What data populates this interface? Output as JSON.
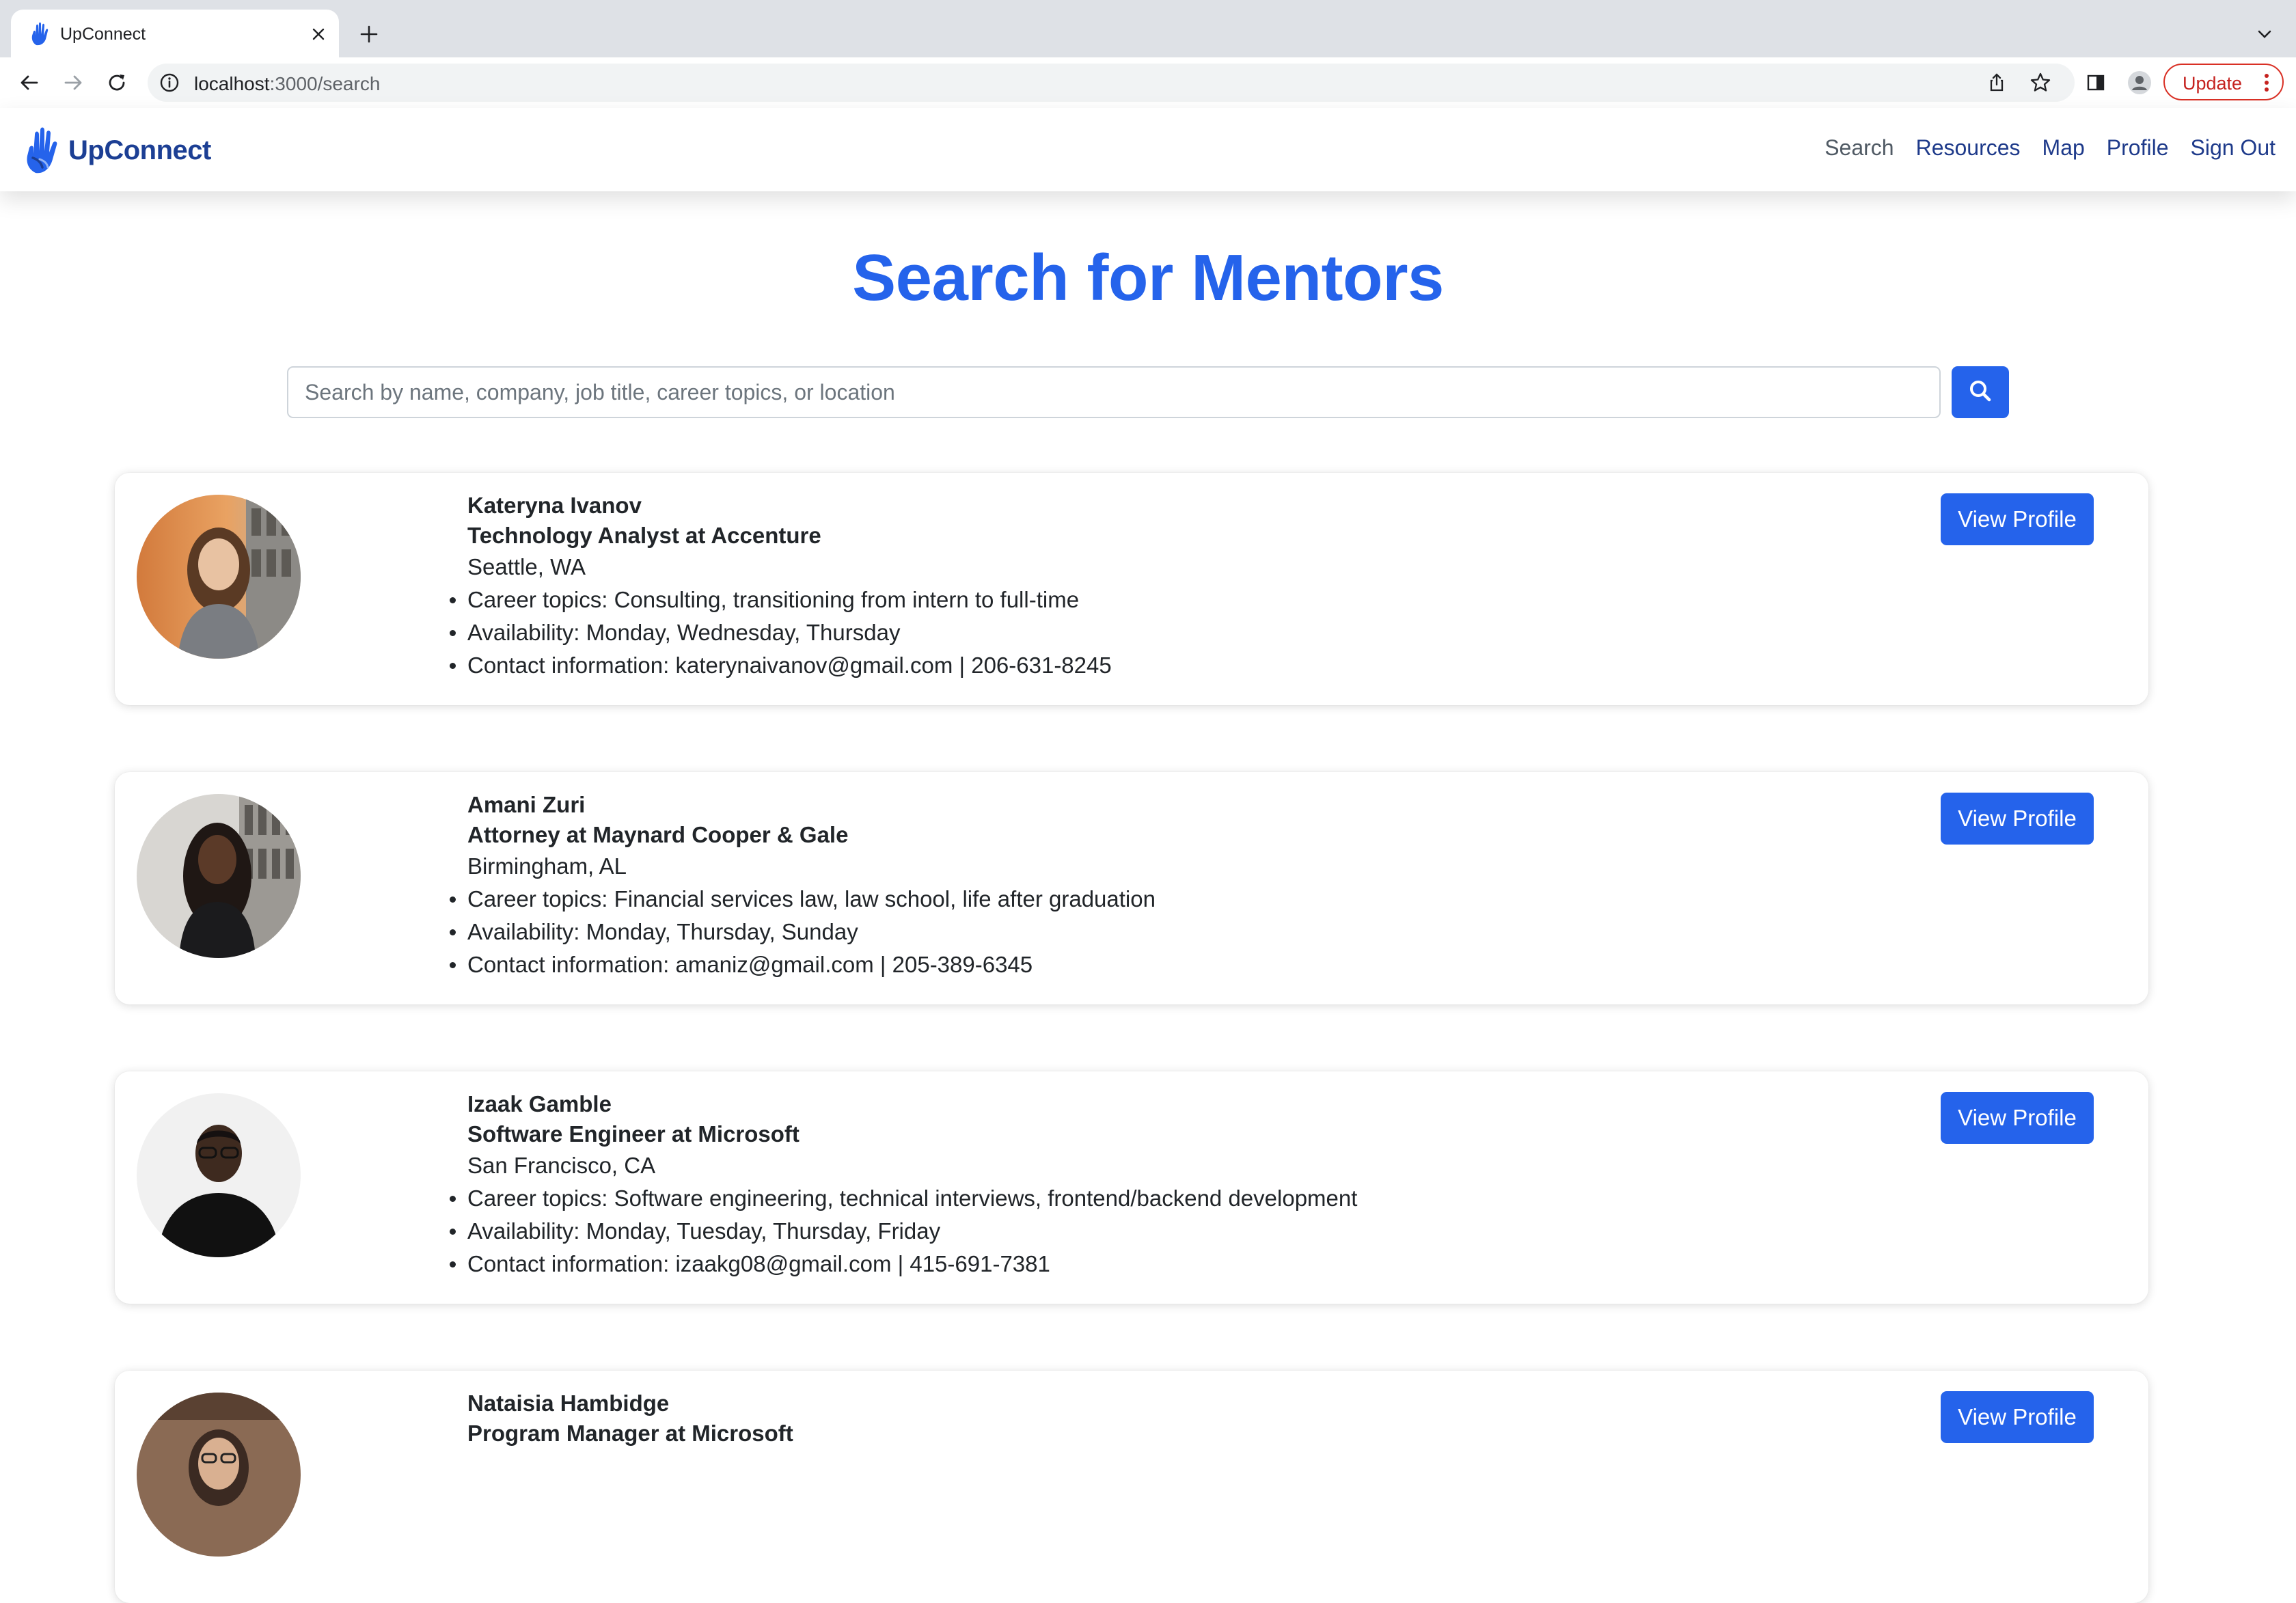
{
  "browser": {
    "tab_title": "UpConnect",
    "url_host": "localhost",
    "url_path": ":3000/search",
    "update_label": "Update"
  },
  "navbar": {
    "brand": "UpConnect",
    "links": [
      {
        "label": "Search"
      },
      {
        "label": "Resources"
      },
      {
        "label": "Map"
      },
      {
        "label": "Profile"
      },
      {
        "label": "Sign Out"
      }
    ]
  },
  "page": {
    "title": "Search for Mentors",
    "search_placeholder": "Search by name, company, job title, career topics, or location",
    "view_profile_label": "View Profile"
  },
  "mentors": [
    {
      "name": "Kateryna Ivanov",
      "title": "Technology Analyst at Accenture",
      "location": "Seattle, WA",
      "career_topics": "Career topics: Consulting, transitioning from intern to full-time",
      "availability": "Availability: Monday, Wednesday, Thursday",
      "contact": "Contact information: katerynaivanov@gmail.com | 206-631-8245",
      "view_profile": "View Profile"
    },
    {
      "name": "Amani Zuri",
      "title": "Attorney at Maynard Cooper & Gale",
      "location": "Birmingham, AL",
      "career_topics": "Career topics: Financial services law, law school, life after graduation",
      "availability": "Availability: Monday, Thursday, Sunday",
      "contact": "Contact information: amaniz@gmail.com | 205-389-6345",
      "view_profile": "View Profile"
    },
    {
      "name": "Izaak Gamble",
      "title": "Software Engineer at Microsoft",
      "location": "San Francisco, CA",
      "career_topics": "Career topics: Software engineering, technical interviews, frontend/backend development",
      "availability": "Availability: Monday, Tuesday, Thursday, Friday",
      "contact": "Contact information: izaakg08@gmail.com | 415-691-7381",
      "view_profile": "View Profile"
    },
    {
      "name": "Nataisia Hambidge",
      "title": "Program Manager at Microsoft",
      "view_profile": "View Profile"
    }
  ],
  "colors": {
    "accent": "#2563eb",
    "brand": "#1c3f94",
    "nav_link": "#1e3a8a"
  }
}
